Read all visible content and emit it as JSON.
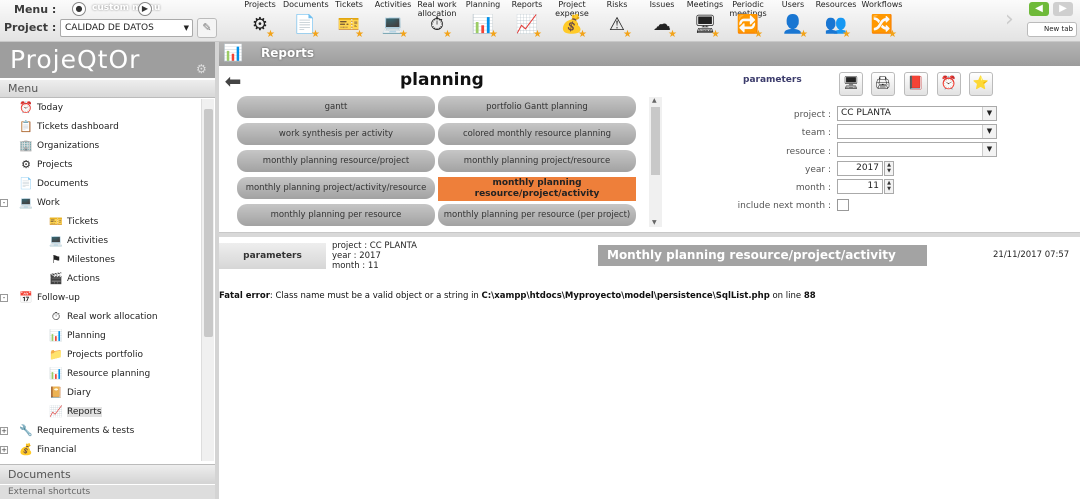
{
  "top": {
    "menu_label": "Menu :",
    "menu_custom": "custom menu",
    "project_label": "Project :",
    "project_value": "CALIDAD DE DATOS",
    "toolbar": [
      {
        "label": "Projects",
        "icon": "⚙"
      },
      {
        "label": "Documents",
        "icon": "📄"
      },
      {
        "label": "Tickets",
        "icon": "🎫"
      },
      {
        "label": "Activities",
        "icon": "💻"
      },
      {
        "label": "Real work allocation",
        "icon": "⏱"
      },
      {
        "label": "Planning",
        "icon": "📊"
      },
      {
        "label": "Reports",
        "icon": "📈"
      },
      {
        "label": "Project expense",
        "icon": "💰"
      },
      {
        "label": "Risks",
        "icon": "⚠"
      },
      {
        "label": "Issues",
        "icon": "☁"
      },
      {
        "label": "Meetings",
        "icon": "🖥"
      },
      {
        "label": "Periodic meetings",
        "icon": "🔁"
      },
      {
        "label": "Users",
        "icon": "👤"
      },
      {
        "label": "Resources",
        "icon": "👥"
      },
      {
        "label": "Workflows",
        "icon": "🔀"
      }
    ],
    "new_tab": "New tab"
  },
  "left": {
    "logo": "ProjeQtOr",
    "menu_header": "Menu",
    "tree": [
      {
        "label": "Today",
        "level": 1,
        "icon": "today-icon"
      },
      {
        "label": "Tickets dashboard",
        "level": 1,
        "icon": "dashboard-icon"
      },
      {
        "label": "Organizations",
        "level": 1,
        "icon": "organizations-icon"
      },
      {
        "label": "Projects",
        "level": 1,
        "icon": "projects-icon"
      },
      {
        "label": "Documents",
        "level": 1,
        "icon": "documents-icon"
      },
      {
        "label": "Work",
        "level": 0,
        "icon": "work-icon",
        "toggle": "-"
      },
      {
        "label": "Tickets",
        "level": 2,
        "icon": "tickets-icon"
      },
      {
        "label": "Activities",
        "level": 2,
        "icon": "activities-icon"
      },
      {
        "label": "Milestones",
        "level": 2,
        "icon": "milestones-icon"
      },
      {
        "label": "Actions",
        "level": 2,
        "icon": "actions-icon"
      },
      {
        "label": "Follow-up",
        "level": 0,
        "icon": "followup-icon",
        "toggle": "-"
      },
      {
        "label": "Real work allocation",
        "level": 2,
        "icon": "realwork-icon"
      },
      {
        "label": "Planning",
        "level": 2,
        "icon": "planning-icon"
      },
      {
        "label": "Projects portfolio",
        "level": 2,
        "icon": "portfolio-icon"
      },
      {
        "label": "Resource planning",
        "level": 2,
        "icon": "resource-planning-icon"
      },
      {
        "label": "Diary",
        "level": 2,
        "icon": "diary-icon"
      },
      {
        "label": "Reports",
        "level": 2,
        "icon": "reports-icon",
        "selected": true
      },
      {
        "label": "Requirements & tests",
        "level": 0,
        "icon": "requirements-icon",
        "toggle": "+"
      },
      {
        "label": "Financial",
        "level": 0,
        "icon": "financial-icon",
        "toggle": "+"
      }
    ],
    "documents_header": "Documents",
    "external_header": "External shortcuts"
  },
  "main": {
    "header_title": "Reports",
    "category_title": "planning",
    "reports": [
      "gantt",
      "portfolio Gantt planning",
      "work synthesis per activity",
      "colored monthly resource planning",
      "monthly planning resource/project",
      "monthly planning project/resource",
      "monthly planning project/activity/resource",
      "monthly planning resource/project/activity",
      "monthly planning per resource",
      "monthly planning per resource (per project)"
    ],
    "selected_report_index": 7,
    "params": {
      "title": "parameters",
      "project_label": "project :",
      "project_value": "CC PLANTA",
      "team_label": "team :",
      "team_value": "",
      "resource_label": "resource :",
      "resource_value": "",
      "year_label": "year :",
      "year_value": "2017",
      "month_label": "month :",
      "month_value": "11",
      "include_label": "include next month :"
    },
    "result": {
      "param_box": "parameters",
      "line1": "project : CC PLANTA",
      "line2": "year : 2017",
      "line3": "month : 11",
      "title": "Monthly planning resource/project/activity",
      "date": "21/11/2017 07:57",
      "error_prefix": "Fatal error",
      "error_text": ": Class name must be a valid object or a string in ",
      "error_path": "C:\\xampp\\htdocs\\Myproyecto\\model\\persistence\\SqlList.php",
      "error_online": " on line ",
      "error_line": "88"
    }
  },
  "colors": {
    "accent": "#ee7f3a",
    "header_gray": "#a3a3a3",
    "toolbar_star": "#f2a31a"
  }
}
